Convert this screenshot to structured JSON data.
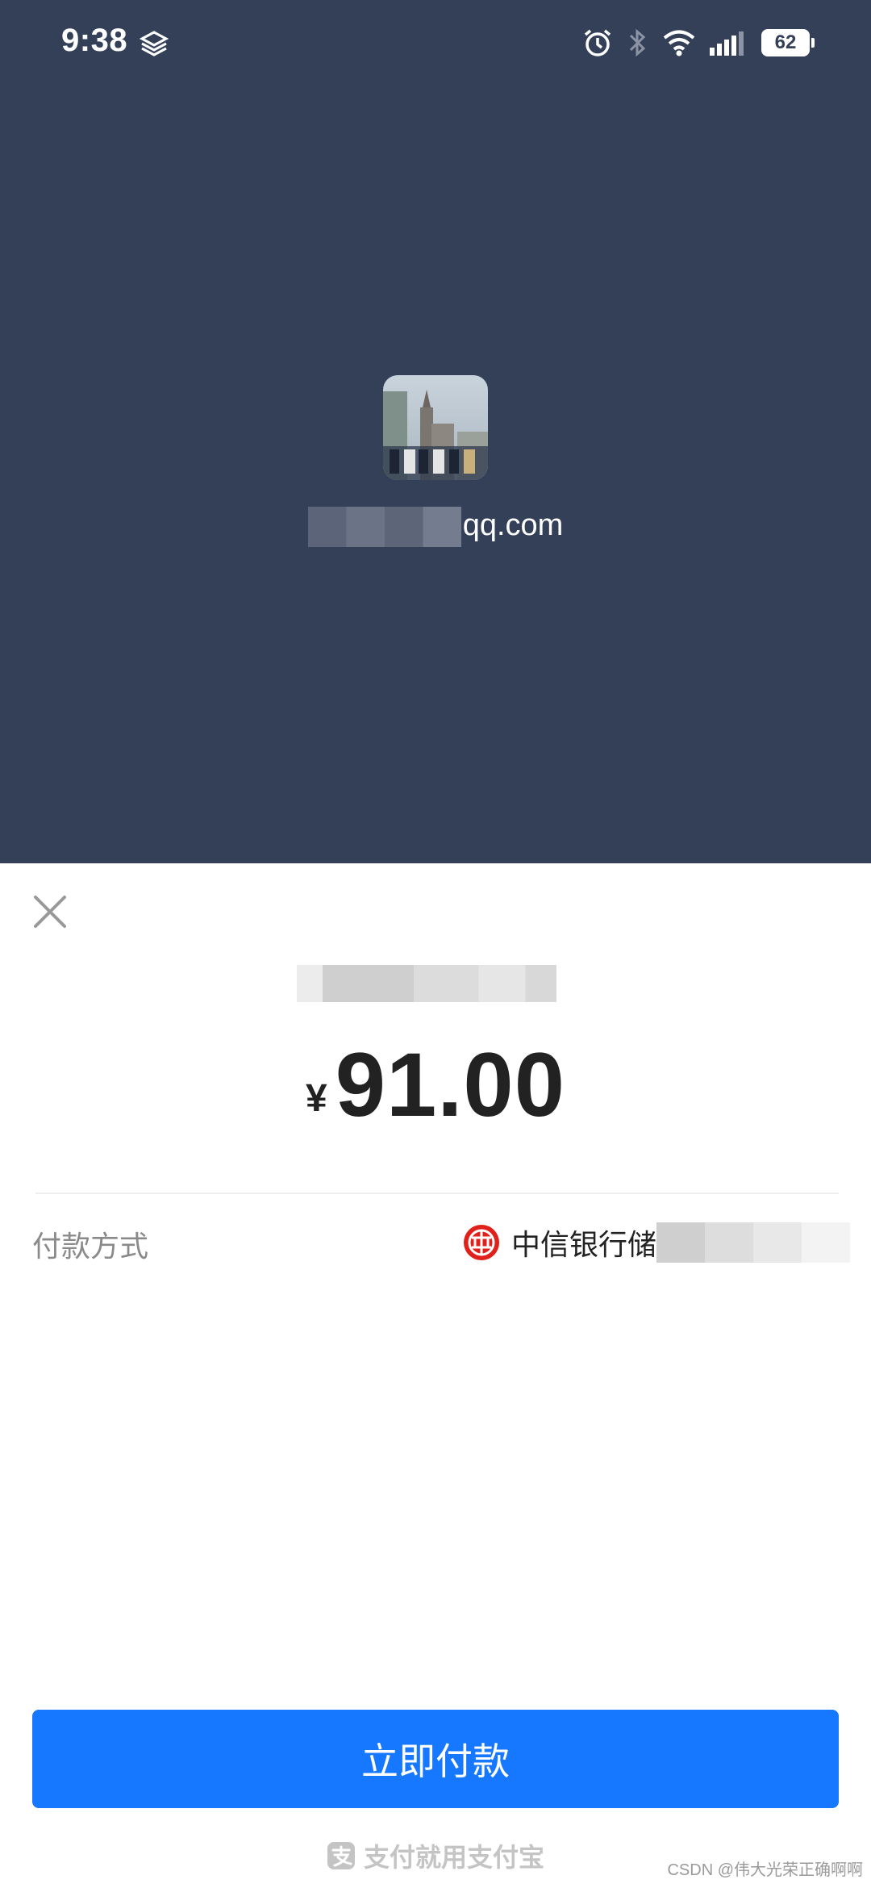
{
  "status_bar": {
    "time": "9:38",
    "battery": "62",
    "icons": [
      "carrier-icon",
      "alarm-icon",
      "bluetooth-icon",
      "wifi-icon",
      "signal-icon",
      "battery-icon"
    ]
  },
  "account": {
    "suffix": "qq.com"
  },
  "sheet": {
    "amount_currency": "¥",
    "amount": "91.00",
    "pay_method_label": "付款方式",
    "pay_method_value": "中信银行储",
    "pay_button_label": "立即付款",
    "footer_text": "支付就用支付宝"
  },
  "watermark": "CSDN @伟大光荣正确啊啊",
  "colors": {
    "header_bg": "#334058",
    "primary_button": "#1677ff",
    "bank_logo_red": "#e0211b"
  }
}
